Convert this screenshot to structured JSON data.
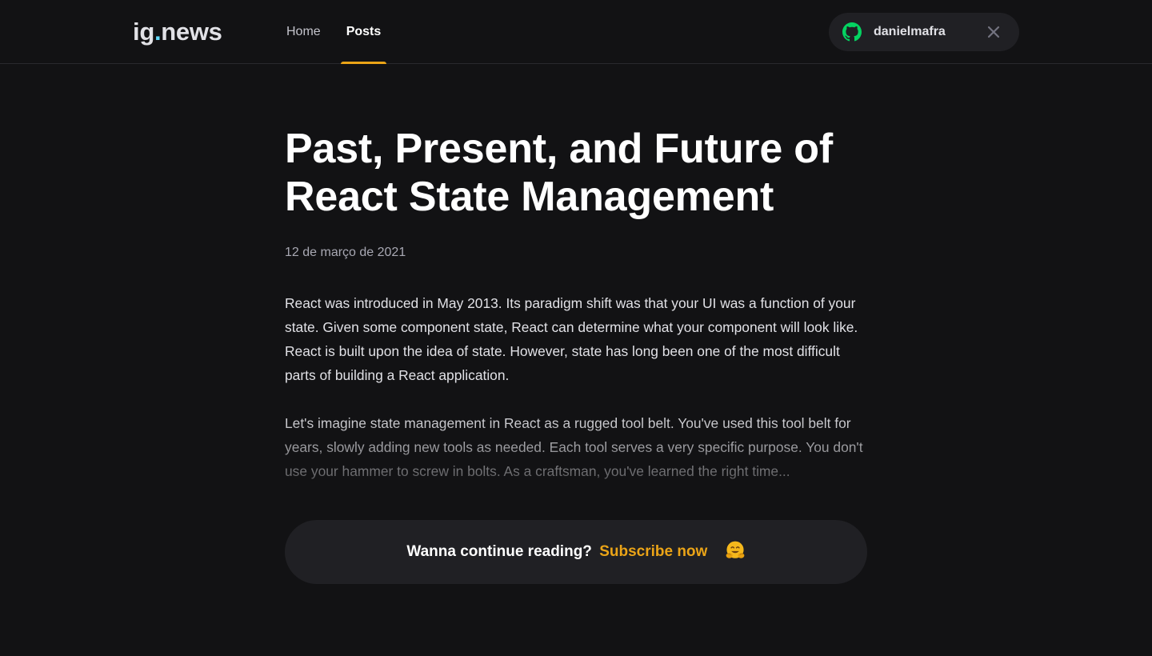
{
  "header": {
    "logo_main": "ig",
    "logo_dot": ".",
    "logo_suffix": "news",
    "nav": {
      "home": "Home",
      "posts": "Posts"
    },
    "user": {
      "username": "danielmafra",
      "provider_icon": "github-icon",
      "close_icon": "close-icon"
    }
  },
  "article": {
    "title": "Past, Present, and Future of React State Management",
    "date": "12 de março de 2021",
    "paragraphs": [
      "React was introduced in May 2013. Its paradigm shift was that your UI was a function of your state. Given some component state, React can determine what your component will look like. React is built upon the idea of state. However, state has long been one of the most difficult parts of building a React application.",
      "Let's imagine state management in React as a rugged tool belt. You've used this tool belt for years, slowly adding new tools as needed. Each tool serves a very specific purpose. You don't use your hammer to screw in bolts. As a craftsman, you've learned the right time..."
    ]
  },
  "continue_reading": {
    "prompt": "Wanna continue reading?",
    "link": "Subscribe now",
    "emoji_icon": "hugging-face-icon"
  },
  "colors": {
    "background": "#121214",
    "surface": "#202024",
    "accent": "#eba417",
    "logo_dot": "#61dafb",
    "github_green": "#04d361"
  }
}
